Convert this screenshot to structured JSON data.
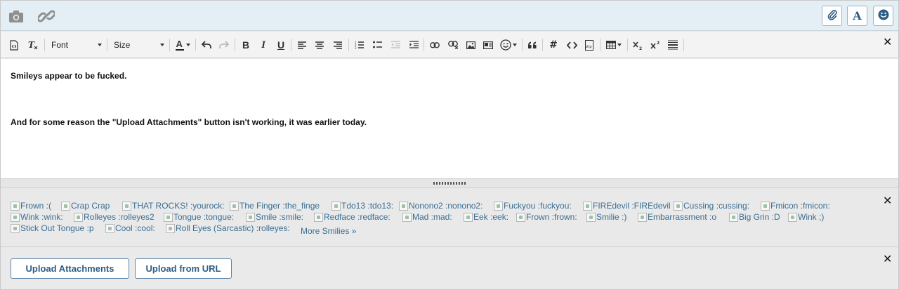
{
  "topbar": {
    "left_icons": [
      "camera-icon",
      "link-icon"
    ],
    "right_buttons": [
      {
        "name": "attach-button",
        "icon": "paperclip-icon"
      },
      {
        "name": "font-style-button",
        "icon": "letter-a-icon",
        "label": "A"
      },
      {
        "name": "smiley-button",
        "icon": "smiley-icon"
      }
    ]
  },
  "toolbar": {
    "font_label": "Font",
    "size_label": "Size",
    "color_label": "A",
    "bold_label": "B",
    "italic_label": "I",
    "underline_label": "U",
    "hash_label": "#",
    "php_label": "php",
    "close_label": "✕"
  },
  "editor": {
    "line1": "Smileys appear to be fucked.",
    "line2": "And for some reason the \"Upload Attachments\" button isn't working, it was earlier today."
  },
  "smilies": {
    "close_label": "✕",
    "items": [
      "Frown :(",
      "Crap Crap",
      "THAT ROCKS! :yourock:",
      "The Finger :the_finge",
      "Tdo13 :tdo13:",
      "Nonono2 :nonono2:",
      "Fuckyou :fuckyou:",
      "FIREdevil :FIREdevil",
      "Cussing :cussing:",
      "Fmicon :fmicon:",
      "Wink :wink:",
      "Rolleyes :rolleyes2",
      "Tongue :tongue:",
      "Smile :smile:",
      "Redface :redface:",
      "Mad :mad:",
      "Eek :eek:",
      "Frown :frown:",
      "Smilie :)",
      "Embarrassment :o",
      "Big Grin :D",
      "Wink ;)",
      "Stick Out Tongue :p",
      "Cool :cool:",
      "Roll Eyes (Sarcastic) :rolleyes:"
    ],
    "more_label": "More Smilies »"
  },
  "attachments": {
    "close_label": "✕",
    "upload_label": "Upload Attachments",
    "url_label": "Upload from URL"
  },
  "colors": {
    "topbar_bg": "#e3eef5",
    "link": "#3a6f95",
    "button_text": "#2b5d86"
  }
}
